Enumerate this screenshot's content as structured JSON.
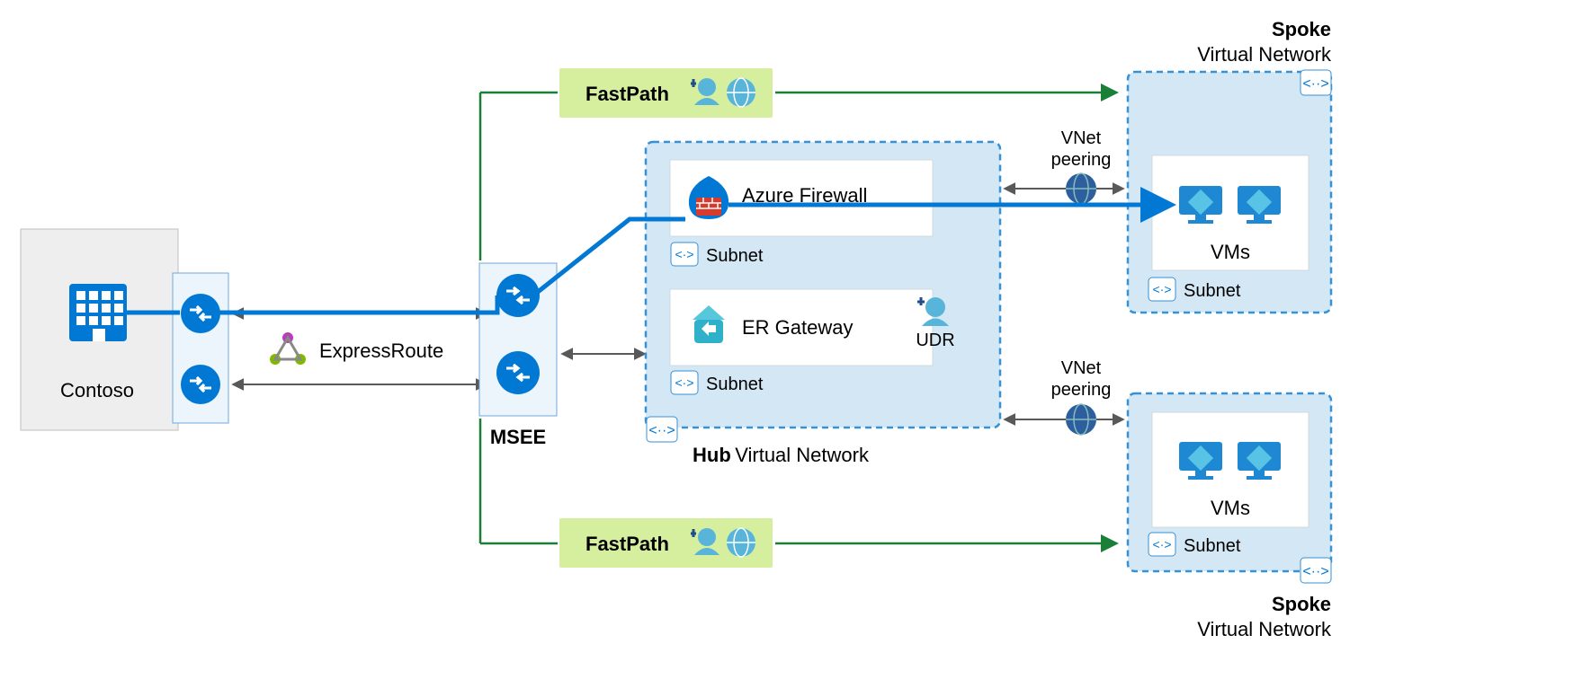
{
  "onprem": {
    "name": "Contoso"
  },
  "expressroute": {
    "label": "ExpressRoute"
  },
  "msee": {
    "label": "MSEE"
  },
  "fastpath": {
    "label": "FastPath"
  },
  "hub": {
    "title_bold": "Hub",
    "title_rest": "Virtual Network",
    "firewall": {
      "label": "Azure Firewall",
      "subnet": "Subnet"
    },
    "gateway": {
      "label": "ER Gateway",
      "subnet": "Subnet",
      "udr": "UDR"
    }
  },
  "peering": {
    "label1": "VNet",
    "label2": "peering"
  },
  "spoke1": {
    "title": "Spoke",
    "subtitle": "Virtual Network",
    "vms": "VMs",
    "subnet": "Subnet"
  },
  "spoke2": {
    "title": "Spoke",
    "subtitle": "Virtual Network",
    "vms": "VMs",
    "subnet": "Subnet"
  },
  "colors": {
    "azureBlue": "#0078d4",
    "darkBlue": "#204e8a",
    "lightBlue": "#d4e7f5",
    "panelGrey": "#eeeeee",
    "green": "#1a7f37",
    "fastpathGreen": "#d5ef9f",
    "cyan": "#3dc1d3",
    "arrow": "#595959"
  }
}
